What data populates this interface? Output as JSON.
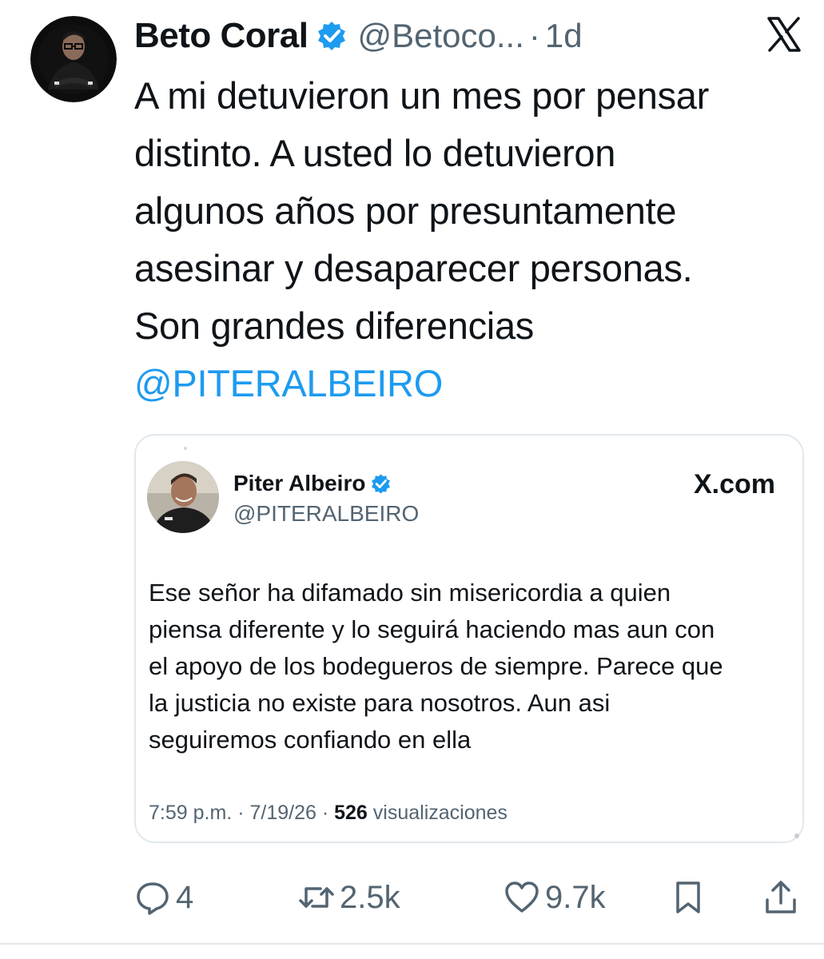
{
  "tweet": {
    "author": {
      "name": "Beto Coral",
      "handle": "@Betoco...",
      "verified": true,
      "avatar_icon": "profile-photo-man-glasses"
    },
    "separator": "·",
    "time": "1d",
    "platform_icon": "x-logo-icon",
    "text_lines": [
      "A mi detuvieron un mes por pensar",
      "distinto. A usted lo detuvieron",
      "algunos años por presuntamente",
      "asesinar y desaparecer personas.",
      "Son grandes diferencias"
    ],
    "mention": "@PITERALBEIRO",
    "quoted": {
      "author": {
        "name": "Piter Albeiro",
        "handle": "@PITERALBEIRO",
        "verified": true,
        "avatar_icon": "profile-photo-man-smiling"
      },
      "site": "X.com",
      "text_lines": [
        "Ese señor ha difamado sin misericordia a quien",
        "piensa diferente y lo seguirá haciendo mas aun con",
        "el apoyo de los bodegueros de siempre. Parece que",
        "la justicia no existe para nosotros. Aun asi",
        "seguiremos confiando en ella"
      ],
      "meta": {
        "time": "7:59 p.m.",
        "date": "7/19/26",
        "separator": "·",
        "views_count": "526",
        "views_label": "visualizaciones"
      }
    },
    "actions": {
      "reply": {
        "icon": "reply-icon",
        "count": "4"
      },
      "retweet": {
        "icon": "retweet-icon",
        "count": "2.5k"
      },
      "like": {
        "icon": "heart-icon",
        "count": "9.7k"
      },
      "bookmark": {
        "icon": "bookmark-icon"
      },
      "share": {
        "icon": "share-icon"
      }
    }
  },
  "colors": {
    "text": "#0f1419",
    "muted": "#536471",
    "link": "#1d9bf0",
    "verified": "#1d9bf0",
    "border": "#e1e8ed"
  }
}
